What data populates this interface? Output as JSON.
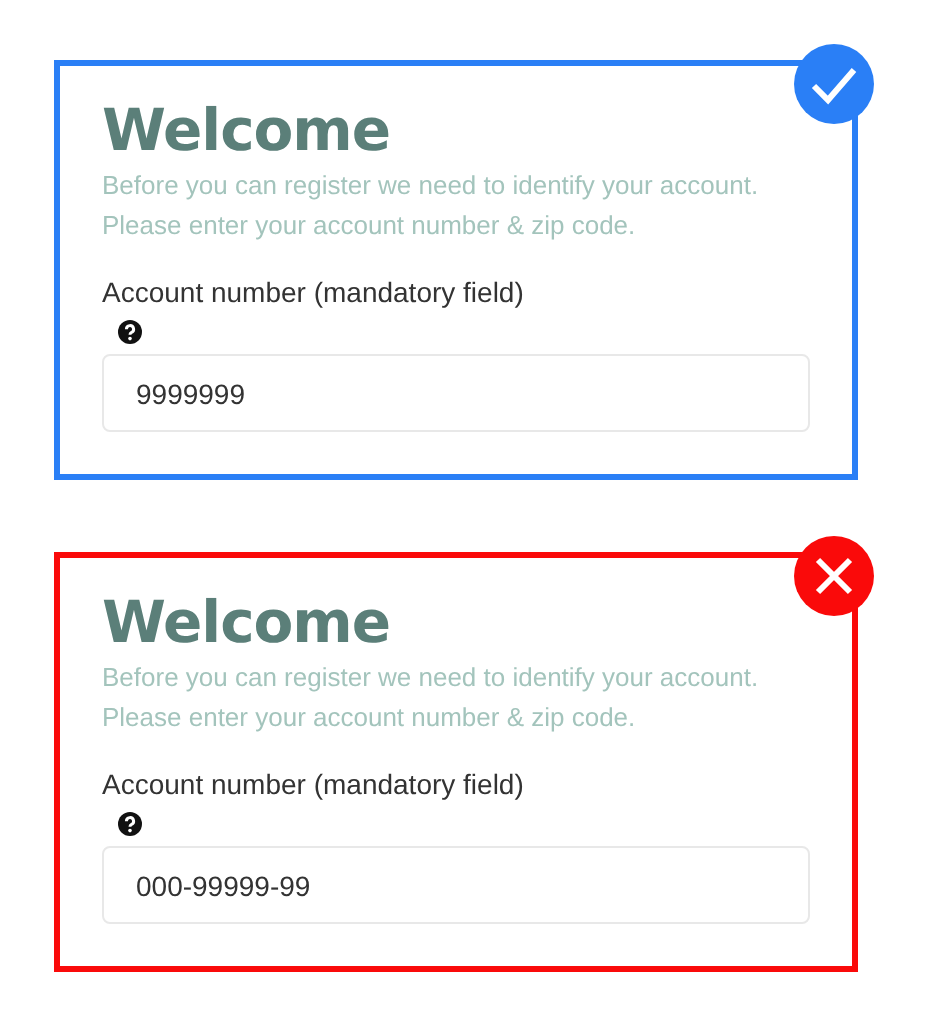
{
  "panels": [
    {
      "valid": true,
      "title": "Welcome",
      "description": "Before you can register we need to identify your account. Please enter your account number & zip code.",
      "field_label": "Account number (mandatory field)",
      "value": "9999999"
    },
    {
      "valid": false,
      "title": "Welcome",
      "description": "Before you can register we need to identify your account. Please enter your account number & zip code.",
      "field_label": "Account number (mandatory field)",
      "value": "000-99999-99"
    }
  ]
}
